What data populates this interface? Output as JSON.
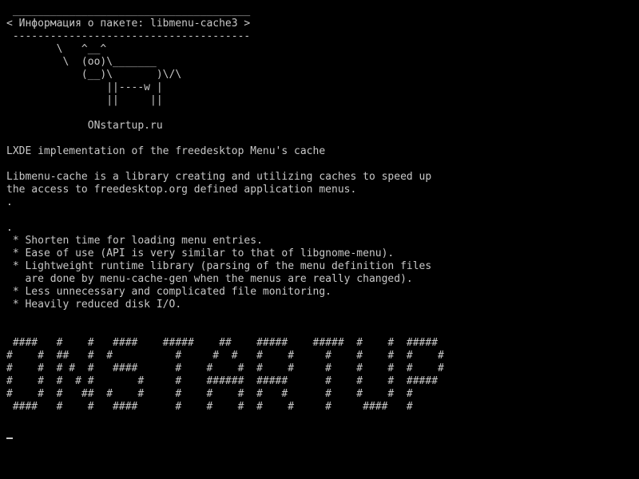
{
  "colors": {
    "background": "#000000",
    "foreground": "#c8c8c8"
  },
  "terminal": {
    "lines": [
      " ______________________________________",
      "< Информация о пакете: libmenu-cache3 >",
      " --------------------------------------",
      "        \\   ^__^",
      "         \\  (oo)\\_______",
      "            (__)\\       )\\/\\",
      "                ||----w |",
      "                ||     ||",
      "",
      "             ONstartup.ru",
      "",
      "LXDE implementation of the freedesktop Menu's cache",
      "",
      "Libmenu-cache is a library creating and utilizing caches to speed up",
      "the access to freedesktop.org defined application menus.",
      ".",
      "",
      ".",
      " * Shorten time for loading menu entries.",
      " * Ease of use (API is very similar to that of libgnome-menu).",
      " * Lightweight runtime library (parsing of the menu definition files",
      "   are done by menu-cache-gen when the menus are really changed).",
      " * Less unnecessary and complicated file monitoring.",
      " * Heavily reduced disk I/O.",
      "",
      "",
      " ####   #    #   ####    #####    ##    #####    #####  #    #  #####",
      "#    #  ##   #  #          #     #  #   #    #     #    #    #  #    #",
      "#    #  # #  #   ####      #    #    #  #    #     #    #    #  #    #",
      "#    #  #  # #       #     #    ######  #####      #    #    #  #####",
      "#    #  #   ##  #    #     #    #    #  #   #      #    #    #  #",
      " ####   #    #   ####      #    #    #  #    #     #     ####   #",
      ""
    ]
  }
}
